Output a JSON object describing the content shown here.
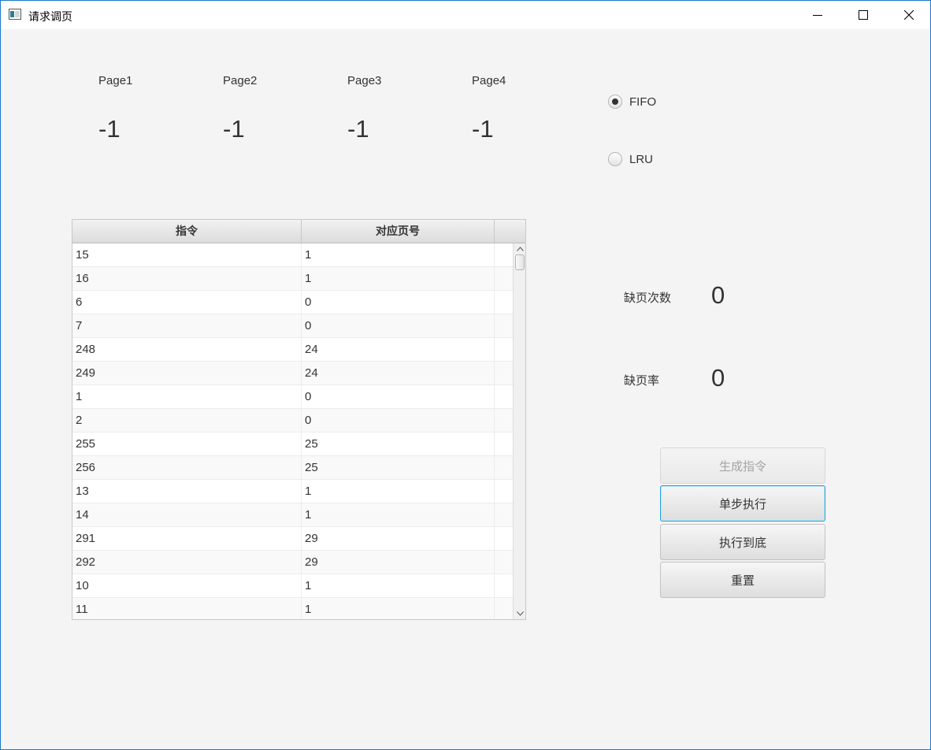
{
  "window": {
    "title": "请求调页",
    "app_icon": "app-window-icon",
    "controls": [
      "minimize-icon",
      "maximize-icon",
      "close-icon"
    ]
  },
  "pages": [
    {
      "label": "Page1",
      "value": "-1"
    },
    {
      "label": "Page2",
      "value": "-1"
    },
    {
      "label": "Page3",
      "value": "-1"
    },
    {
      "label": "Page4",
      "value": "-1"
    }
  ],
  "algorithm": {
    "selected": "FIFO",
    "options": [
      "FIFO",
      "LRU"
    ]
  },
  "table": {
    "columns": [
      "指令",
      "对应页号"
    ],
    "rows": [
      [
        "15",
        "1"
      ],
      [
        "16",
        "1"
      ],
      [
        "6",
        "0"
      ],
      [
        "7",
        "0"
      ],
      [
        "248",
        "24"
      ],
      [
        "249",
        "24"
      ],
      [
        "1",
        "0"
      ],
      [
        "2",
        "0"
      ],
      [
        "255",
        "25"
      ],
      [
        "256",
        "25"
      ],
      [
        "13",
        "1"
      ],
      [
        "14",
        "1"
      ],
      [
        "291",
        "29"
      ],
      [
        "292",
        "29"
      ],
      [
        "10",
        "1"
      ],
      [
        "11",
        "1"
      ]
    ]
  },
  "stats": {
    "faults_label": "缺页次数",
    "faults_value": "0",
    "rate_label": "缺页率",
    "rate_value": "0"
  },
  "buttons": {
    "generate": "生成指令",
    "step": "单步执行",
    "run_all": "执行到底",
    "reset": "重置"
  },
  "colors": {
    "window_border": "#1979ca",
    "background": "#f4f4f4",
    "focus_ring": "#2aa3d8"
  }
}
